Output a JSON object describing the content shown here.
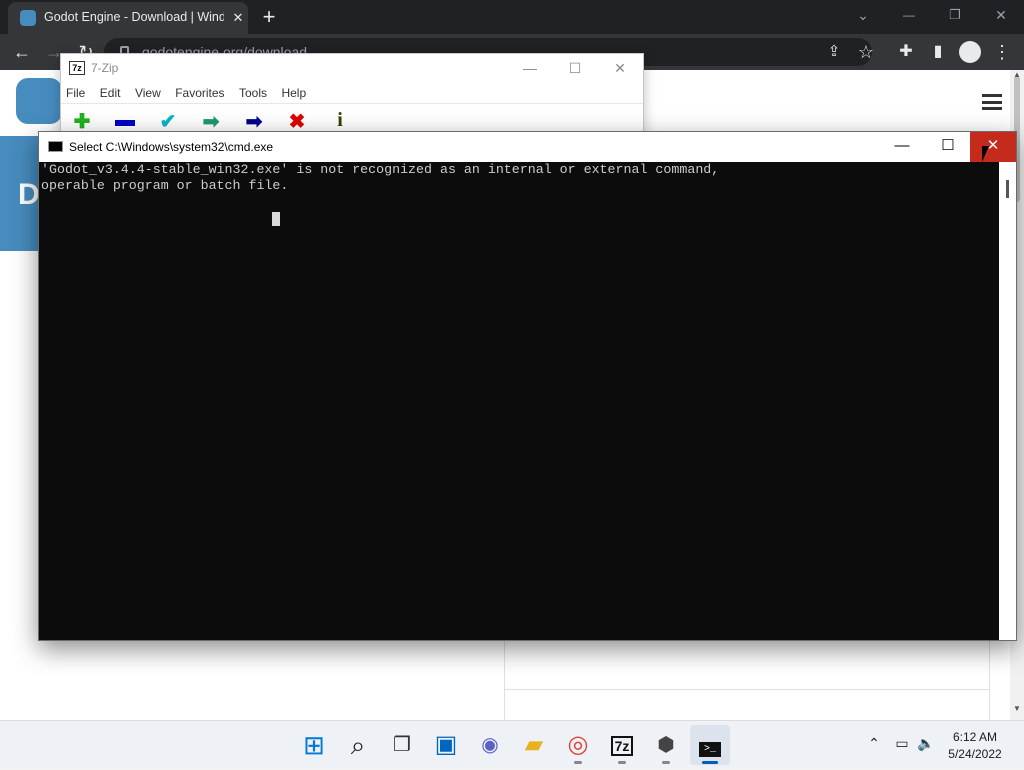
{
  "browser": {
    "tab_title": "Godot Engine - Download | Wind",
    "url": "godotengine.org/download",
    "icons": [
      "godot-favicon",
      "close-icon",
      "new-tab-icon",
      "back-icon",
      "forward-icon",
      "reload-icon",
      "lock-icon",
      "share-icon",
      "star-icon",
      "extensions-icon",
      "sidebar-icon",
      "profile-icon",
      "menu-icon"
    ],
    "tab_close": "✕",
    "new_tab": "+",
    "back": "←",
    "forward": "→",
    "reload": "↻",
    "win_min": "—",
    "win_restore": "❐",
    "win_close": "✕",
    "tab_search": "⌄"
  },
  "webpage": {
    "hero_letter": "D"
  },
  "zip": {
    "title": "7-Zip",
    "app_icon": "7z",
    "menu": [
      "File",
      "Edit",
      "View",
      "Favorites",
      "Tools",
      "Help"
    ],
    "tools": [
      {
        "icon": "add-icon",
        "glyph": "✚",
        "color": "#1fb31f"
      },
      {
        "icon": "extract-icon",
        "glyph": "▬",
        "color": "#0000c8"
      },
      {
        "icon": "test-icon",
        "glyph": "✔",
        "color": "#00b8c8"
      },
      {
        "icon": "copy-icon",
        "glyph": "➡",
        "color": "#1a9a6a"
      },
      {
        "icon": "move-icon",
        "glyph": "➡",
        "color": "#00008b"
      },
      {
        "icon": "delete-icon",
        "glyph": "✖",
        "color": "#e00000"
      },
      {
        "icon": "info-icon",
        "glyph": "i",
        "color": "#3a3a00"
      }
    ]
  },
  "cmd": {
    "title": "Select C:\\Windows\\system32\\cmd.exe",
    "lines": [
      "'Godot_v3.4.4-stable_win32.exe' is not recognized as an internal or external command,",
      "operable program or batch file."
    ]
  },
  "taskbar": {
    "apps": [
      {
        "name": "start",
        "glyph": "⊞",
        "color": "#0078d4",
        "running": false
      },
      {
        "name": "search",
        "glyph": "⌕",
        "color": "#222222",
        "running": false
      },
      {
        "name": "task-view",
        "glyph": "❐",
        "color": "#333333",
        "running": false
      },
      {
        "name": "widgets",
        "glyph": "▣",
        "color": "#0067c0",
        "running": false
      },
      {
        "name": "chat",
        "glyph": "◉",
        "color": "#5b5fc7",
        "running": false
      },
      {
        "name": "file-explorer",
        "glyph": "▰",
        "color": "#e8b21c",
        "running": false
      },
      {
        "name": "chrome",
        "glyph": "◎",
        "color": "#db4437",
        "running": true
      },
      {
        "name": "7-zip",
        "glyph": "7z",
        "color": "#111111",
        "running": true
      },
      {
        "name": "unity",
        "glyph": "⬢",
        "color": "#444444",
        "running": true
      },
      {
        "name": "cmd",
        "glyph": ">_",
        "color": "#ffffff",
        "running": true,
        "active": true
      }
    ],
    "time": "6:12 AM",
    "date": "5/24/2022"
  }
}
